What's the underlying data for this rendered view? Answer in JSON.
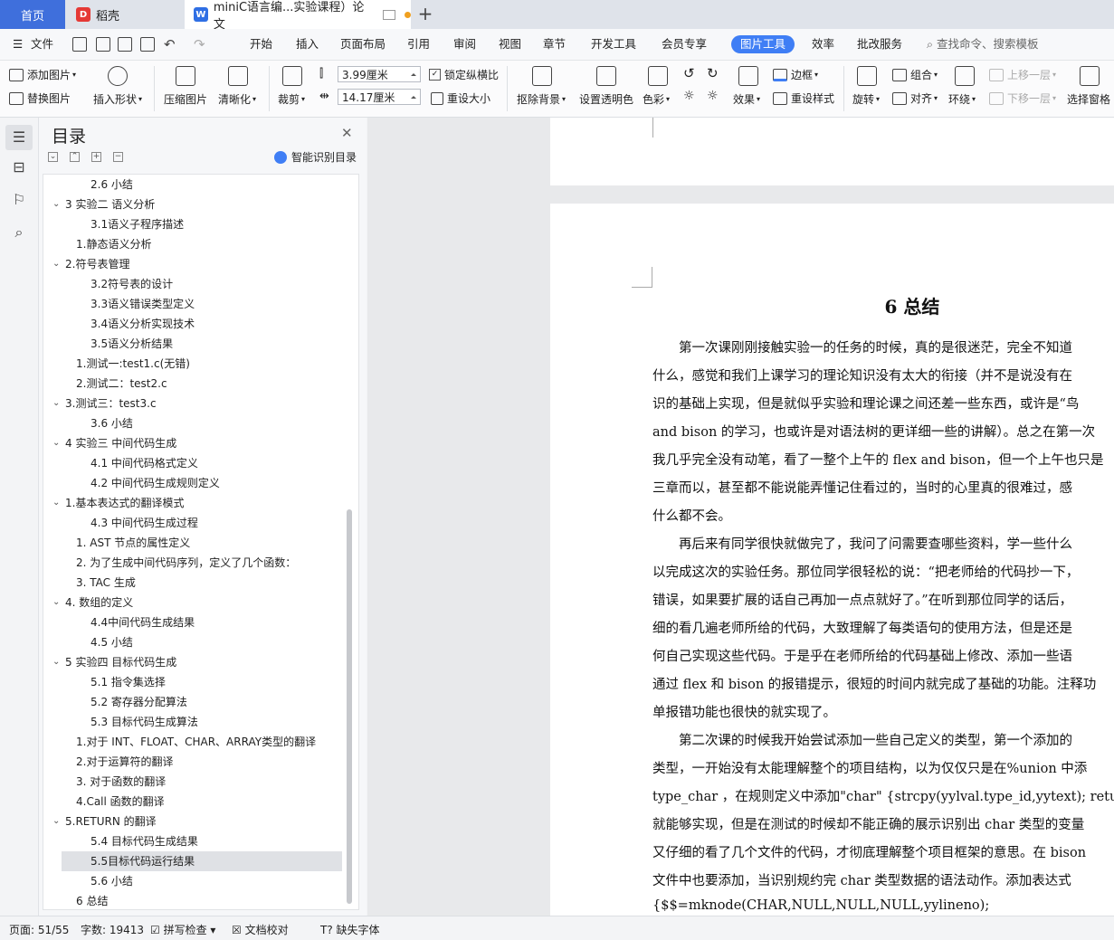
{
  "tabs": {
    "home": "首页",
    "daoke": "稻壳",
    "doc": "miniC语言编...实验课程）论文"
  },
  "menu": {
    "file": "文件",
    "items": [
      "开始",
      "插入",
      "页面布局",
      "引用",
      "审阅",
      "视图",
      "章节",
      "开发工具",
      "会员专享",
      "图片工具",
      "效率",
      "批改服务"
    ],
    "search": "查找命令、搜索模板"
  },
  "ribbon": {
    "add_image": "添加图片",
    "replace_image": "替换图片",
    "insert_shape": "插入形状",
    "compress": "压缩图片",
    "clarify": "清晰化",
    "crop": "裁剪",
    "height": "3.99厘米",
    "width": "14.17厘米",
    "lock_ratio": "锁定纵横比",
    "reset_size": "重设大小",
    "remove_bg": "抠除背景",
    "set_transparent": "设置透明色",
    "color": "色彩",
    "effects": "效果",
    "border": "边框",
    "reset_style": "重设样式",
    "rotate": "旋转",
    "group": "组合",
    "align": "对齐",
    "wrap": "环绕",
    "bring_forward": "上移一层",
    "send_backward": "下移一层",
    "selection_pane": "选择窗格"
  },
  "toc": {
    "title": "目录",
    "smart_label": "智能识别目录",
    "items": [
      {
        "text": "2.6  小结",
        "level": 2,
        "chev": false
      },
      {
        "text": "3  实验二  语义分析",
        "level": 0,
        "chev": true
      },
      {
        "text": "3.1语义子程序描述",
        "level": 2,
        "chev": false
      },
      {
        "text": "1.静态语义分析",
        "level": 1,
        "chev": false
      },
      {
        "text": "2.符号表管理",
        "level": 0,
        "chev": true
      },
      {
        "text": "3.2符号表的设计",
        "level": 2,
        "chev": false
      },
      {
        "text": "3.3语义错误类型定义",
        "level": 2,
        "chev": false
      },
      {
        "text": "3.4语义分析实现技术",
        "level": 2,
        "chev": false
      },
      {
        "text": "3.5语义分析结果",
        "level": 2,
        "chev": false
      },
      {
        "text": "1.测试一:test1.c(无错)",
        "level": 1,
        "chev": false
      },
      {
        "text": "2.测试二：test2.c",
        "level": 1,
        "chev": false
      },
      {
        "text": "3.测试三：test3.c",
        "level": 0,
        "chev": true
      },
      {
        "text": "3.6 小结",
        "level": 2,
        "chev": false
      },
      {
        "text": "4  实验三  中间代码生成",
        "level": 0,
        "chev": true
      },
      {
        "text": "4.1  中间代码格式定义",
        "level": 2,
        "chev": false
      },
      {
        "text": "4.2  中间代码生成规则定义",
        "level": 2,
        "chev": false
      },
      {
        "text": "1.基本表达式的翻译模式",
        "level": 0,
        "chev": true
      },
      {
        "text": "4.3  中间代码生成过程",
        "level": 2,
        "chev": false
      },
      {
        "text": "1.   AST 节点的属性定义",
        "level": 1,
        "chev": false
      },
      {
        "text": "2.  为了生成中间代码序列，定义了几个函数：",
        "level": 1,
        "chev": false
      },
      {
        "text": "3.  TAC 生成",
        "level": 1,
        "chev": false
      },
      {
        "text": "4.  数组的定义",
        "level": 0,
        "chev": true
      },
      {
        "text": "4.4中间代码生成结果",
        "level": 2,
        "chev": false
      },
      {
        "text": "4.5  小结",
        "level": 2,
        "chev": false
      },
      {
        "text": "5  实验四  目标代码生成",
        "level": 0,
        "chev": true
      },
      {
        "text": "5.1  指令集选择",
        "level": 2,
        "chev": false
      },
      {
        "text": "5.2  寄存器分配算法",
        "level": 2,
        "chev": false
      },
      {
        "text": "5.3  目标代码生成算法",
        "level": 2,
        "chev": false
      },
      {
        "text": "1.对于 INT、FLOAT、CHAR、ARRAY类型的翻译",
        "level": 1,
        "chev": false
      },
      {
        "text": "2.对于运算符的翻译",
        "level": 1,
        "chev": false
      },
      {
        "text": "3.  对于函数的翻译",
        "level": 1,
        "chev": false
      },
      {
        "text": "4.Call 函数的翻译",
        "level": 1,
        "chev": false
      },
      {
        "text": "5.RETURN 的翻译",
        "level": 0,
        "chev": true
      },
      {
        "text": "5.4  目标代码生成结果",
        "level": 2,
        "chev": false
      },
      {
        "text": "5.5目标代码运行结果",
        "level": 2,
        "chev": false,
        "selected": true
      },
      {
        "text": "5.6  小结",
        "level": 2,
        "chev": false
      },
      {
        "text": "6  总结",
        "level": 1,
        "chev": false
      }
    ]
  },
  "document": {
    "title": "6  总结",
    "lines": [
      "　　第一次课刚刚接触实验一的任务的时候，真的是很迷茫，完全不知道",
      "什么，感觉和我们上课学习的理论知识没有太大的衔接（并不是说没有在",
      "识的基础上实现，但是就似乎实验和理论课之间还差一些东西，或许是“鸟",
      "and bison 的学习，也或许是对语法树的更详细一些的讲解）。总之在第一次",
      "我几乎完全没有动笔，看了一整个上午的 flex and bison，但一个上午也只是",
      "三章而以，甚至都不能说能弄懂记住看过的，当时的心里真的很难过，感",
      "什么都不会。",
      "　　再后来有同学很快就做完了，我问了问需要查哪些资料，学一些什么",
      "以完成这次的实验任务。那位同学很轻松的说：“把老师给的代码抄一下，",
      "错误，如果要扩展的话自己再加一点点就好了。”在听到那位同学的话后，",
      "细的看几遍老师所给的代码，大致理解了每类语句的使用方法，但是还是",
      "何自己实现这些代码。于是乎在老师所给的代码基础上修改、添加一些语",
      "通过 flex 和 bison 的报错提示，很短的时间内就完成了基础的功能。注释功",
      "单报错功能也很快的就实现了。",
      "　　第二次课的时候我开始尝试添加一些自己定义的类型，第一个添加的",
      "类型，一开始没有太能理解整个的项目结构，以为仅仅只是在%union 中添",
      "type_char ，在规则定义中添加\"char\" {strcpy(yylval.type_id,yytext); return",
      "就能够实现，但是在测试的时候却不能正确的展示识别出 char 类型的变量",
      "又仔细的看了几个文件的代码，才彻底理解整个项目框架的意思。在 bison",
      "文件中也要添加，当识别规约完 char 类型数据的语法动作。添加表达式",
      "{$$=mknode(CHAR,NULL,NULL,NULL,yylineno);"
    ]
  },
  "status": {
    "page": "页面: 51/55",
    "words": "字数: 19413",
    "spell": "拼写检查",
    "proof": "文档校对",
    "missing_font": "缺失字体"
  },
  "colors": {
    "accent": "#3f7ef5",
    "home_tab": "#3f6fdc"
  }
}
